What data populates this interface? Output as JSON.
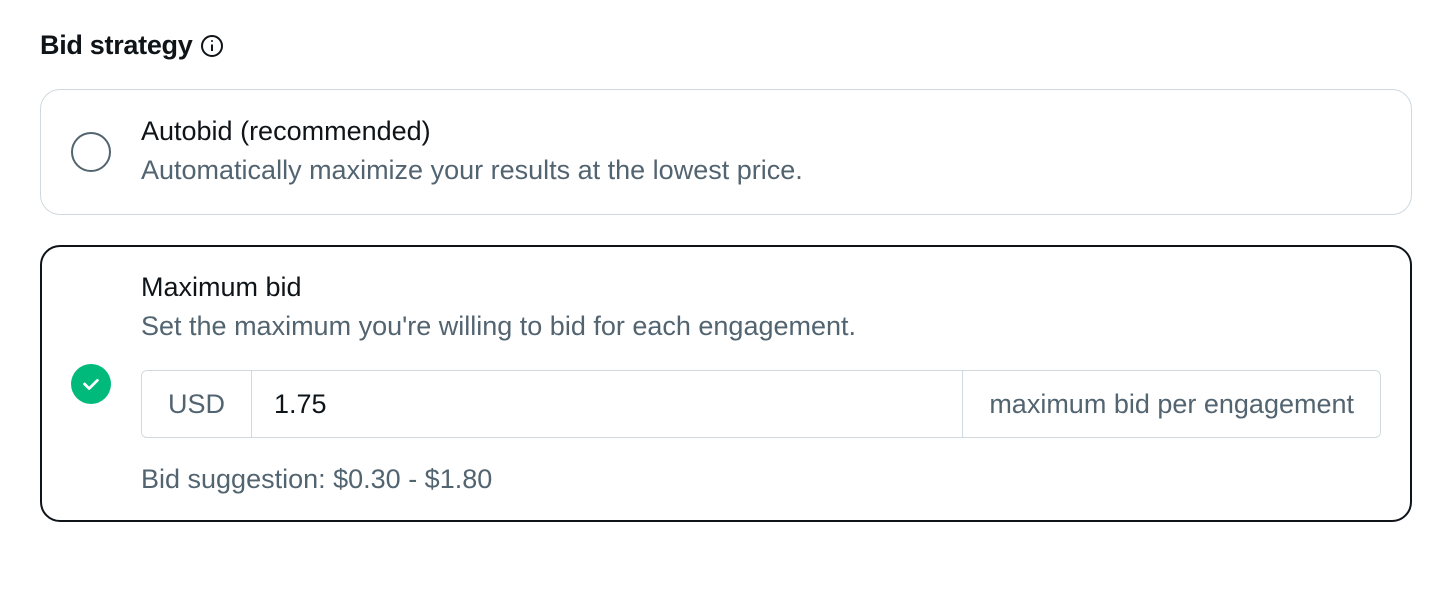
{
  "section": {
    "title": "Bid strategy"
  },
  "options": {
    "autobid": {
      "title": "Autobid (recommended)",
      "desc": "Automatically maximize your results at the lowest price."
    },
    "maxbid": {
      "title": "Maximum bid",
      "desc": "Set the maximum you're willing to bid for each engagement.",
      "currency": "USD",
      "value": "1.75",
      "unit": "maximum bid per engagement",
      "suggestion": "Bid suggestion: $0.30 - $1.80"
    }
  },
  "colors": {
    "text_primary": "#0f1419",
    "text_secondary": "#536471",
    "border": "#cfd9de",
    "success": "#00ba7c"
  }
}
